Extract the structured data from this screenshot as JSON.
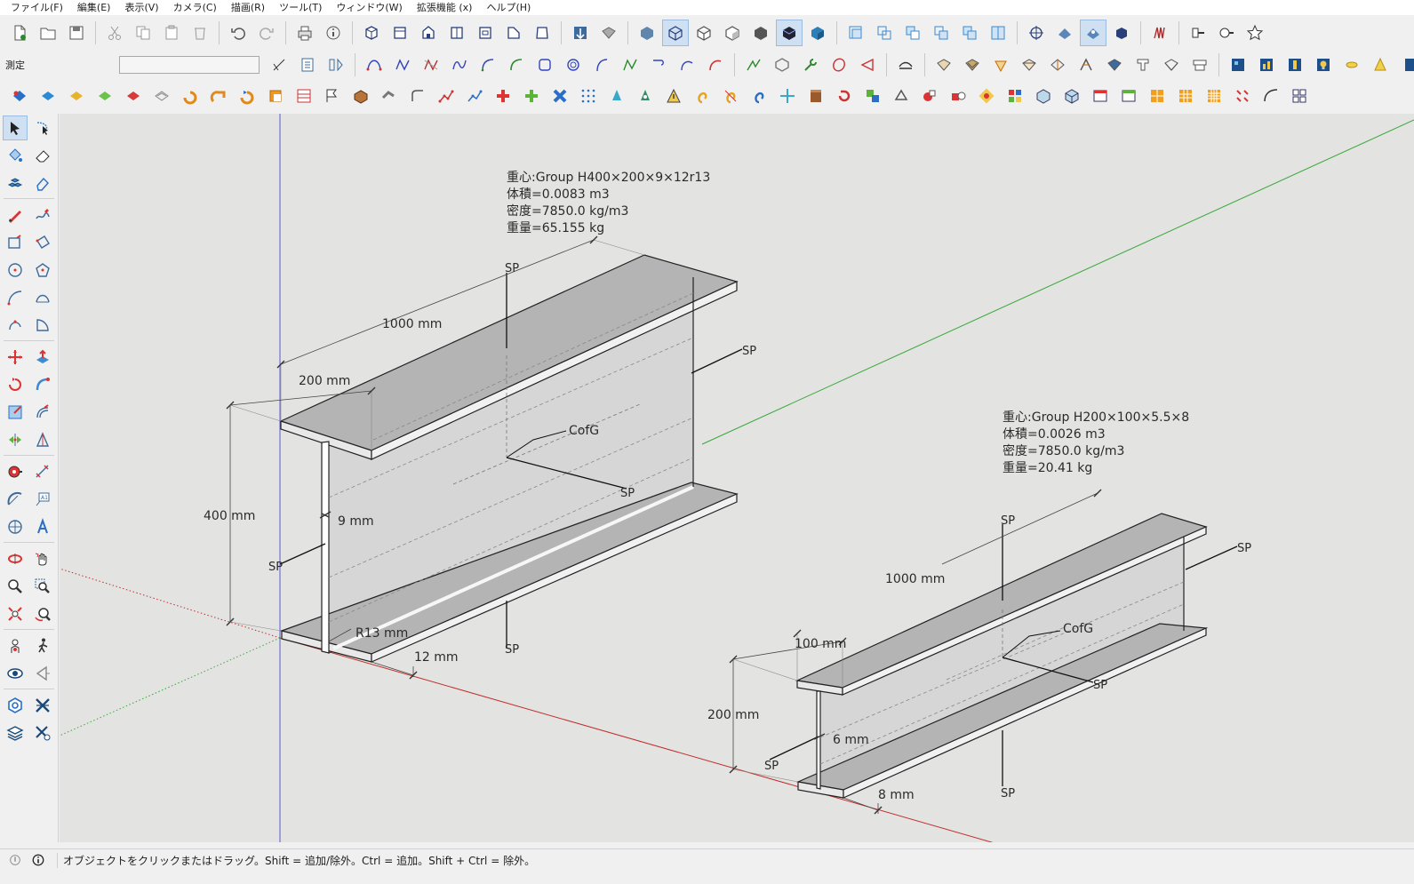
{
  "menu": [
    "ファイル(F)",
    "編集(E)",
    "表示(V)",
    "カメラ(C)",
    "描画(R)",
    "ツール(T)",
    "ウィンドウ(W)",
    "拡張機能 (x)",
    "ヘルプ(H)"
  ],
  "measure": {
    "label": "測定",
    "value": ""
  },
  "status": {
    "text": "オブジェクトをクリックまたはドラッグ。Shift = 追加/除外。Ctrl = 追加。Shift + Ctrl = 除外。"
  },
  "beam_large": {
    "info": [
      "重心:Group H400×200×9×12r13",
      "体積=0.0083 m3",
      "密度=7850.0 kg/m3",
      "重量=65.155 kg"
    ],
    "dim_length": "1000 mm",
    "dim_width": "200 mm",
    "dim_height": "400 mm",
    "dim_web": "9 mm",
    "dim_radius": "R13 mm",
    "dim_flange": "12 mm",
    "cofg": "CofG",
    "sp": "SP"
  },
  "beam_small": {
    "info": [
      "重心:Group H200×100×5.5×8",
      "体積=0.0026 m3",
      "密度=7850.0 kg/m3",
      "重量=20.41 kg"
    ],
    "dim_length": "1000 mm",
    "dim_width": "100 mm",
    "dim_height": "200 mm",
    "dim_web": "6 mm",
    "dim_flange": "8 mm",
    "cofg": "CofG",
    "sp": "SP"
  },
  "colors": {
    "red_axis": "#c0302c",
    "green_axis": "#3aa83a",
    "blue_axis": "#3a3acc",
    "face_top": "#b4b4b4",
    "face_side": "#d9d9d9"
  }
}
